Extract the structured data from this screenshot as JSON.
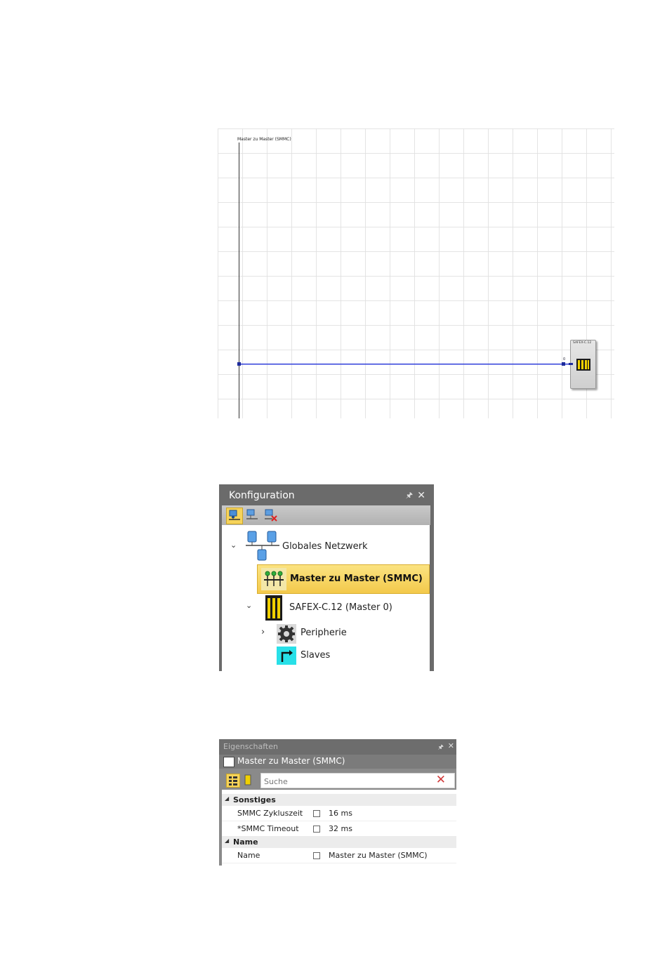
{
  "diagram": {
    "bus_label": "Master zu Master (SMMC)",
    "device_label": "SAFEX-C.12",
    "port_number": "0"
  },
  "konfiguration": {
    "title": "Konfiguration",
    "toolbar": [
      "network-add-icon",
      "network-icon",
      "network-remove-icon"
    ],
    "tree": [
      {
        "label": "Globales Netzwerk",
        "expanded": true
      },
      {
        "label": "Master zu Master (SMMC)",
        "selected": true
      },
      {
        "label": "SAFEX-C.12 (Master 0)",
        "expanded": true
      },
      {
        "label": "Peripherie",
        "expanded": false
      },
      {
        "label": "Slaves"
      }
    ]
  },
  "eigenschaften": {
    "title": "Eigenschaften",
    "object_title": "Master zu Master (SMMC)",
    "search_placeholder": "Suche",
    "categories": [
      {
        "name": "Sonstiges",
        "rows": [
          {
            "name": "SMMC Zykluszeit",
            "value": "16 ms"
          },
          {
            "name": "*SMMC Timeout",
            "value": "32 ms"
          }
        ]
      },
      {
        "name": "Name",
        "rows": [
          {
            "name": "Name",
            "value": "Master zu Master (SMMC)"
          }
        ]
      }
    ]
  },
  "colors": {
    "bus_line": "#2333d6",
    "selection": "#f3c94b",
    "panel_header": "#6b6b6b"
  }
}
